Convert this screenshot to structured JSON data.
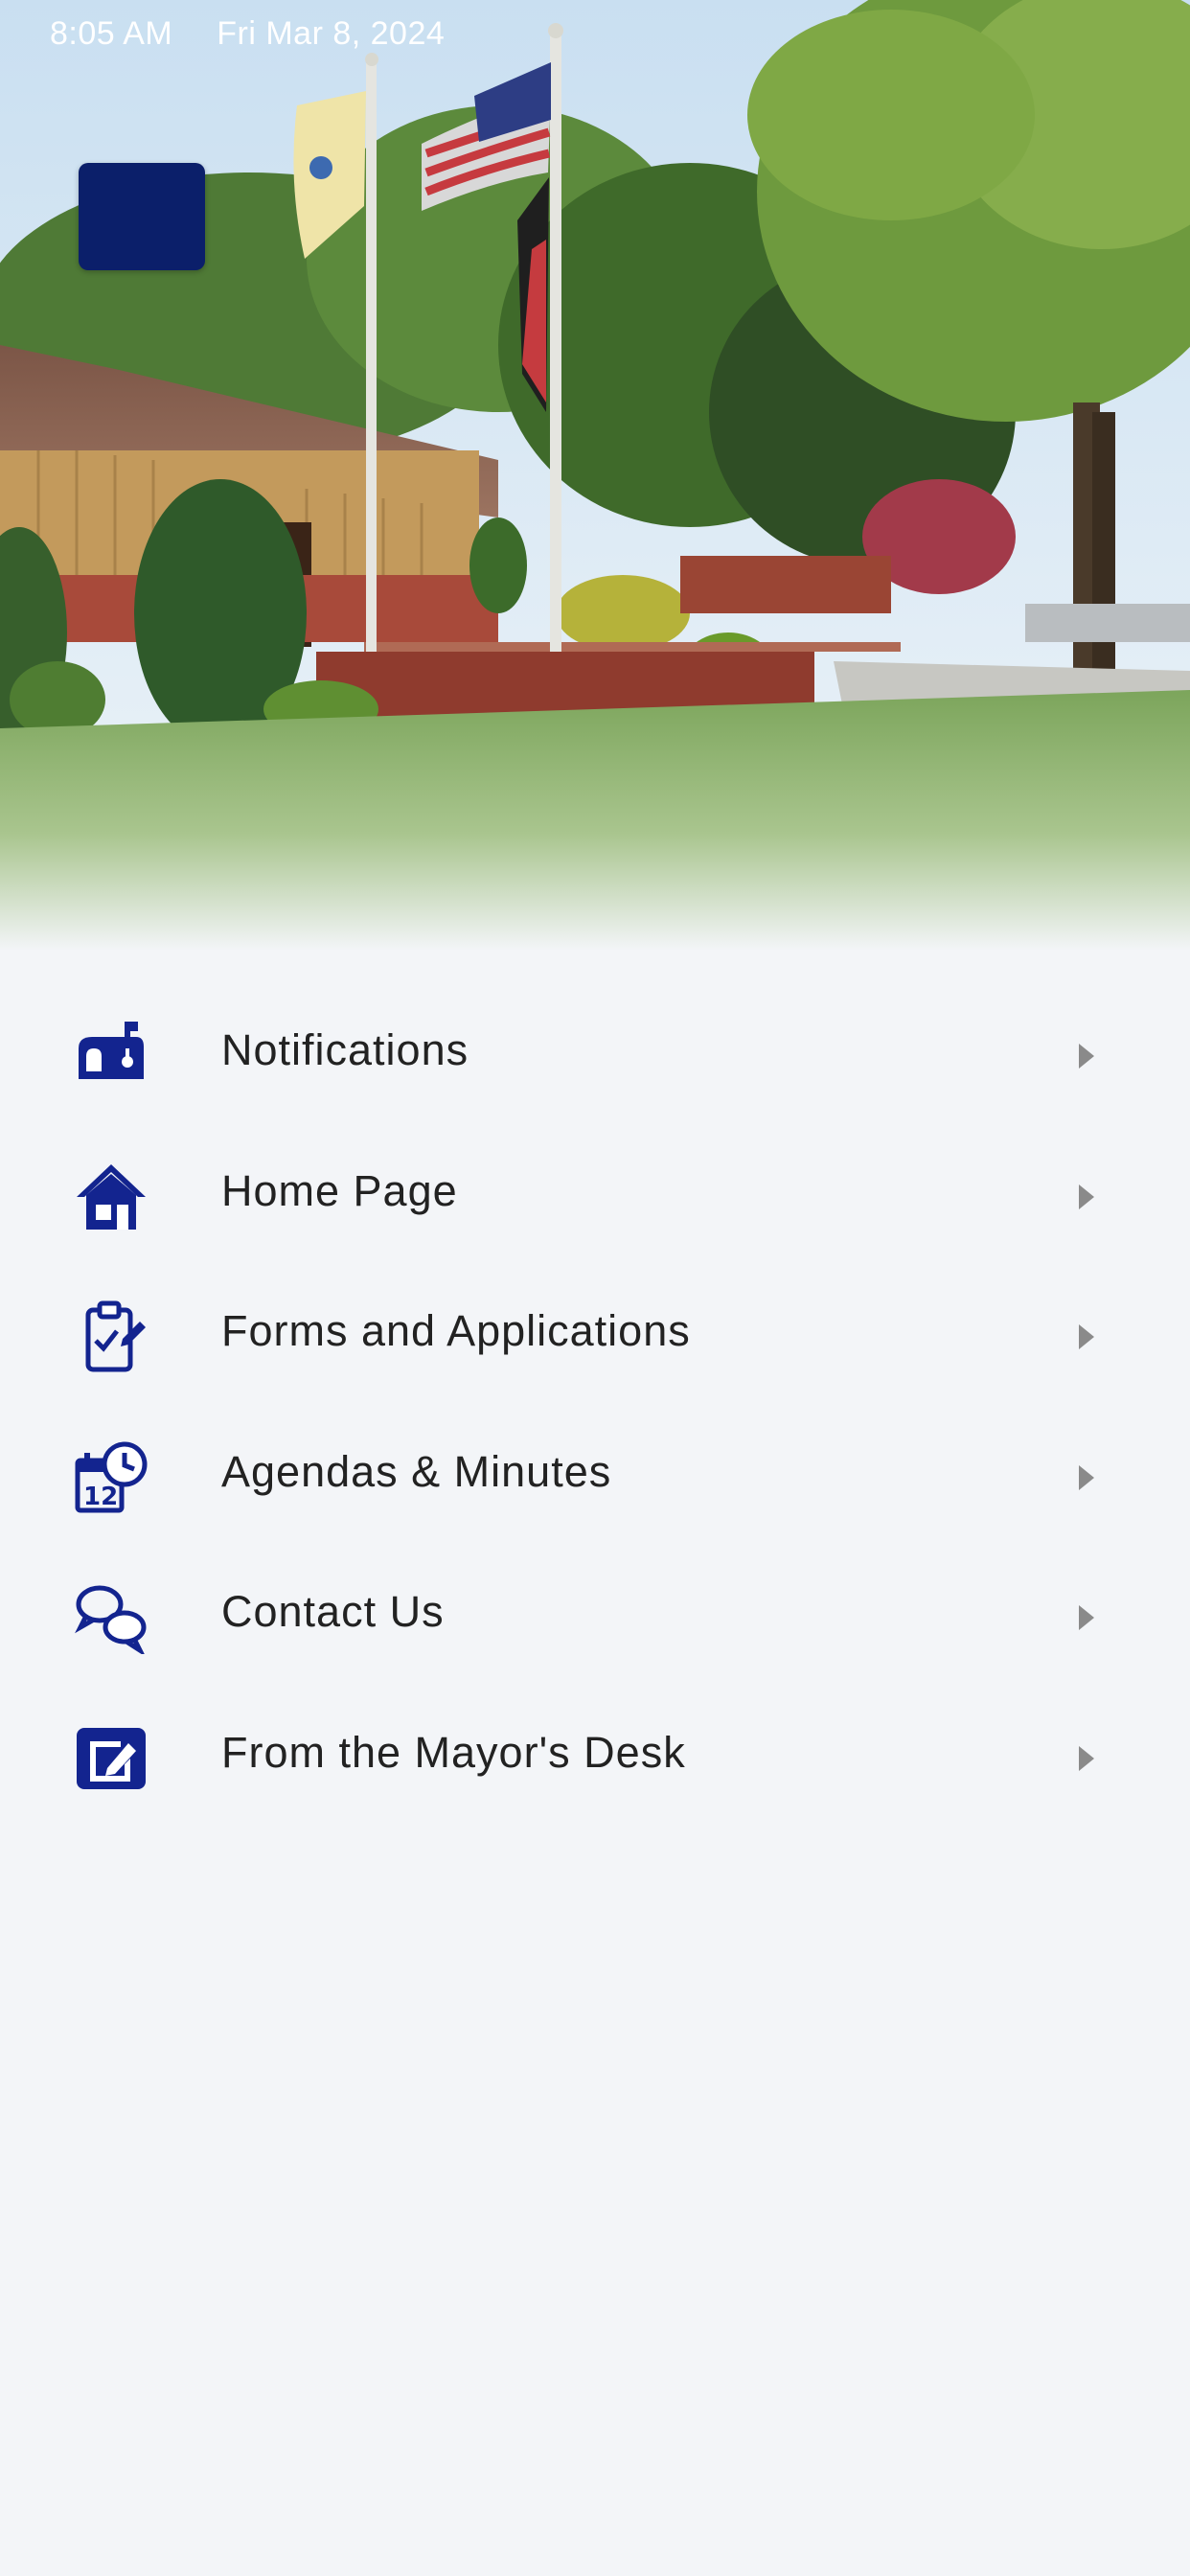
{
  "status_bar": {
    "time": "8:05 AM",
    "date": "Fri Mar 8, 2024"
  },
  "hero": {
    "image": "town-hall-flagpoles-photo"
  },
  "menu_button": {
    "icon": "menu-icon"
  },
  "menu": {
    "items": [
      {
        "label": "Notifications",
        "icon": "mailbox-icon"
      },
      {
        "label": "Home Page",
        "icon": "home-icon"
      },
      {
        "label": "Forms and Applications",
        "icon": "clipboard-edit-icon"
      },
      {
        "label": "Agendas & Minutes",
        "icon": "calendar-clock-icon"
      },
      {
        "label": "Contact Us",
        "icon": "chat-bubbles-icon"
      },
      {
        "label": "From the Mayor's Desk",
        "icon": "notepad-edit-icon"
      }
    ]
  },
  "colors": {
    "accent": "#13248f",
    "menu_button": "#0b1f6a",
    "background": "#f3f5f8",
    "text": "#222222",
    "arrow": "#8a8a8a"
  }
}
